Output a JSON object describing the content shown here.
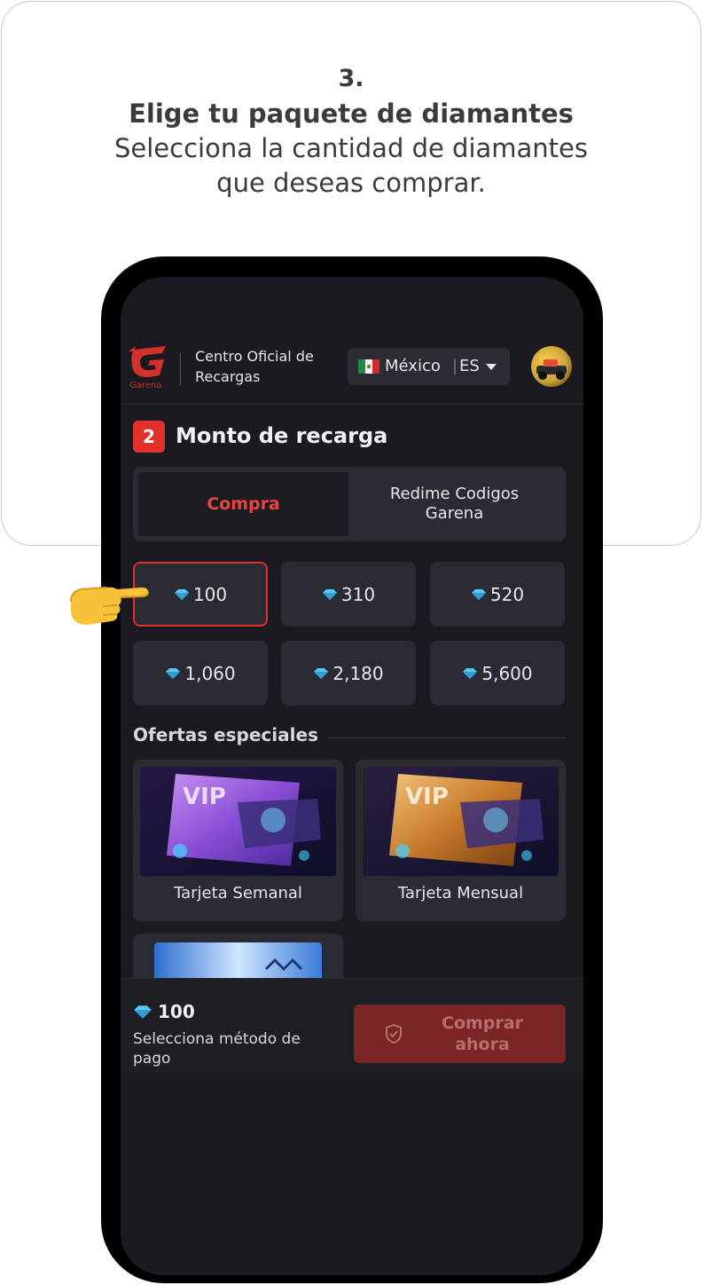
{
  "step": {
    "number": "3.",
    "title": "Elige tu paquete de diamantes",
    "description_line1": "Selecciona la cantidad de diamantes",
    "description_line2": "que deseas comprar."
  },
  "header": {
    "logo_text": "Garena",
    "brand_line1": "Centro Oficial de",
    "brand_line2": "Recargas",
    "country": "México",
    "separator": "|",
    "language": "ES"
  },
  "section": {
    "badge": "2",
    "title": "Monto de recarga"
  },
  "tabs": {
    "active": "Compra",
    "inactive_line1": "Redime Codigos",
    "inactive_line2": "Garena"
  },
  "packages": [
    "100",
    "310",
    "520",
    "1,060",
    "2,180",
    "5,600"
  ],
  "selected_package_index": 0,
  "offers": {
    "title": "Ofertas especiales",
    "items": [
      "Tarjeta Semanal",
      "Tarjeta Mensual"
    ]
  },
  "summary": {
    "amount": "100",
    "subtitle": "Selecciona método de pago",
    "buy_line1": "Comprar",
    "buy_line2": "ahora"
  },
  "colors": {
    "accent": "#e1312c",
    "background": "#1a1a20",
    "card": "#2b2b33",
    "gem": "#58c8f2"
  },
  "icons": [
    "garena-logo-icon",
    "mexico-flag-icon",
    "chevron-down-icon",
    "avatar",
    "diamond-icon",
    "shield-check-icon",
    "pointing-hand-icon"
  ]
}
